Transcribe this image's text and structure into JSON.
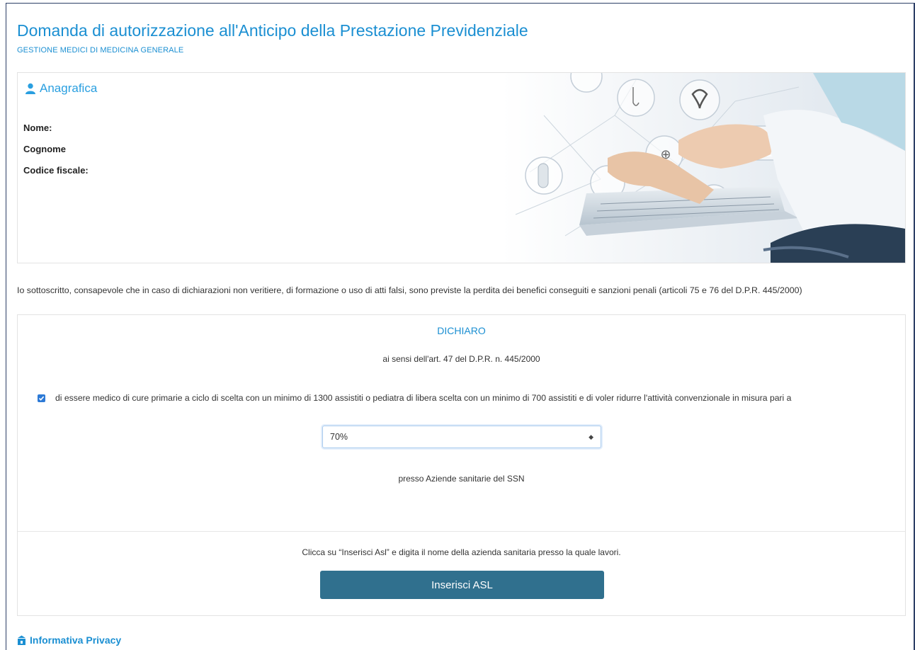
{
  "header": {
    "title": "Domanda di autorizzazione all'Anticipo della Prestazione Previdenziale",
    "subtitle": "GESTIONE MEDICI DI MEDICINA GENERALE"
  },
  "anagrafica": {
    "heading": "Anagrafica",
    "fields": {
      "nome": "Nome:",
      "cognome": "Cognome",
      "codice_fiscale": "Codice fiscale:"
    }
  },
  "declaration": "Io sottoscritto, consapevole che in caso di dichiarazioni non veritiere, di formazione o uso di atti falsi, sono previste la perdita dei benefici conseguiti e sanzioni penali (articoli 75 e 76 del D.P.R. 445/2000)",
  "dichiaro": {
    "title": "DICHIARO",
    "subtitle": "ai sensi dell'art. 47 del D.P.R. n. 445/2000",
    "checkbox_checked": true,
    "checkbox_label": "di essere medico di cure primarie a ciclo di scelta con un minimo di 1300 assistiti o pediatra di libera scelta con un minimo di 700 assistiti e di voler ridurre l'attività convenzionale in misura pari a",
    "select_value": "70%",
    "presso": "presso Aziende sanitarie del SSN",
    "instruction": "Clicca su “Inserisci Asl” e digita il nome della azienda sanitaria presso la quale lavori.",
    "button_label": "Inserisci ASL"
  },
  "privacy": {
    "label": "Informativa Privacy"
  },
  "colors": {
    "accent": "#1b8fd2",
    "button": "#30708e",
    "checkbox": "#2d7ad6"
  }
}
